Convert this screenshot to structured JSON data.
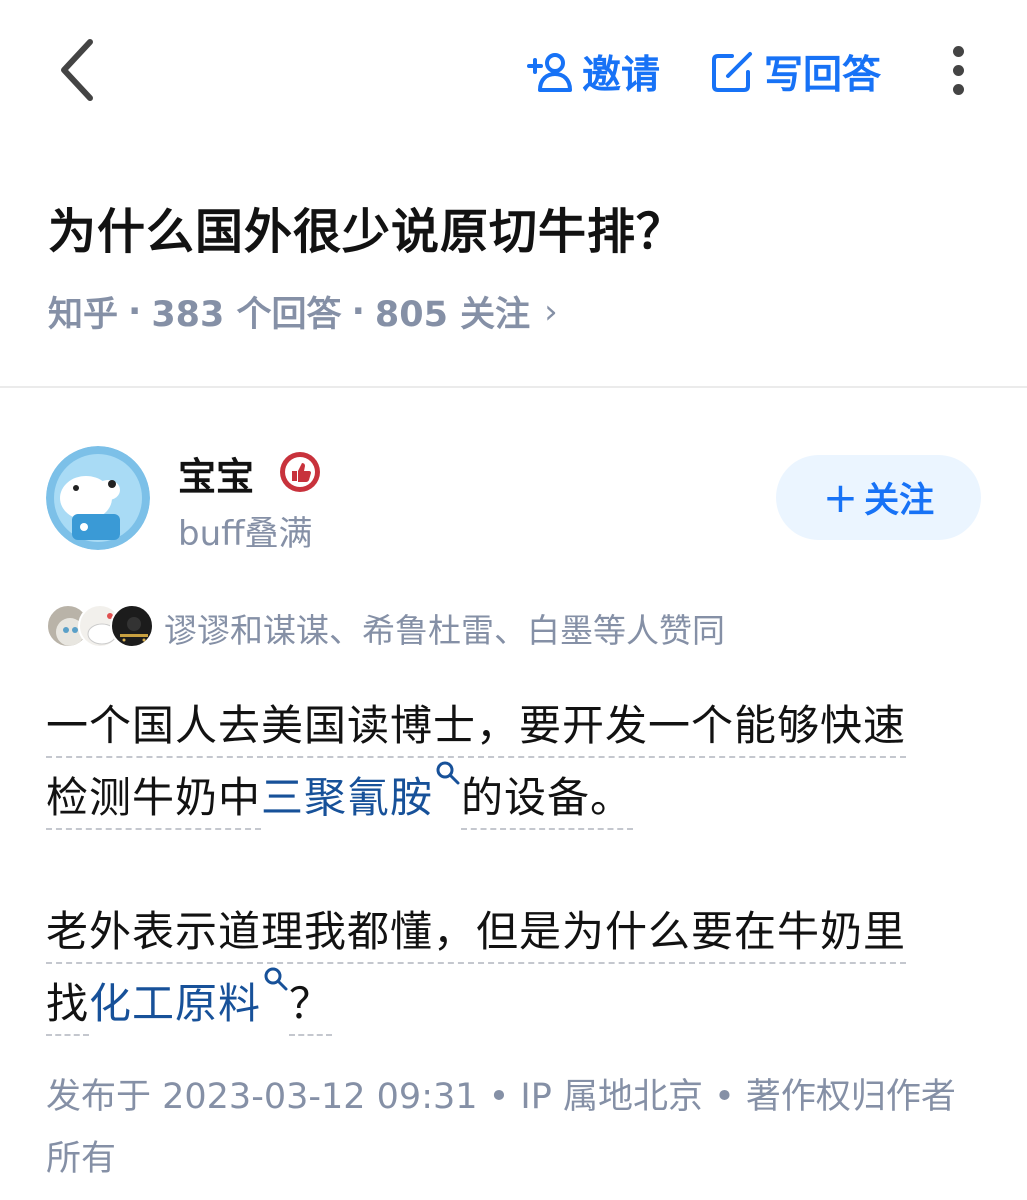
{
  "topbar": {
    "invite_label": "邀请",
    "write_label": "写回答",
    "accent_color": "#1772f6"
  },
  "question": {
    "title": "为什么国外很少说原切牛排？",
    "source": "知乎",
    "answers": "383 个回答",
    "followers": "805 关注",
    "separator": "·",
    "chevron": "›"
  },
  "author": {
    "name": "宝宝",
    "bio": "buff叠满",
    "follow_plus": "+",
    "follow_label": "关注",
    "badge_icon": "thumbs-up-badge-icon"
  },
  "upvoters": {
    "text": "谬谬和谋谋、希鲁杜雷、白墨等人赞同"
  },
  "answer": {
    "p1_line1": "一个国人去美国读博士，要开发一个能够快速",
    "p1_line2_a": "检测牛奶中",
    "p1_keyword": "三聚氰胺",
    "p1_line2_b": "的设备。",
    "p2_line1": "老外表示道理我都懂，但是为什么要在牛奶里",
    "p2_line2_a": "找",
    "p2_keyword": "化工原料",
    "p2_line2_b": "？",
    "keyword_color": "#175199"
  },
  "footer": {
    "text": "发布于 2023-03-12 09:31 • IP 属地北京 • 著作权归作者所有"
  }
}
